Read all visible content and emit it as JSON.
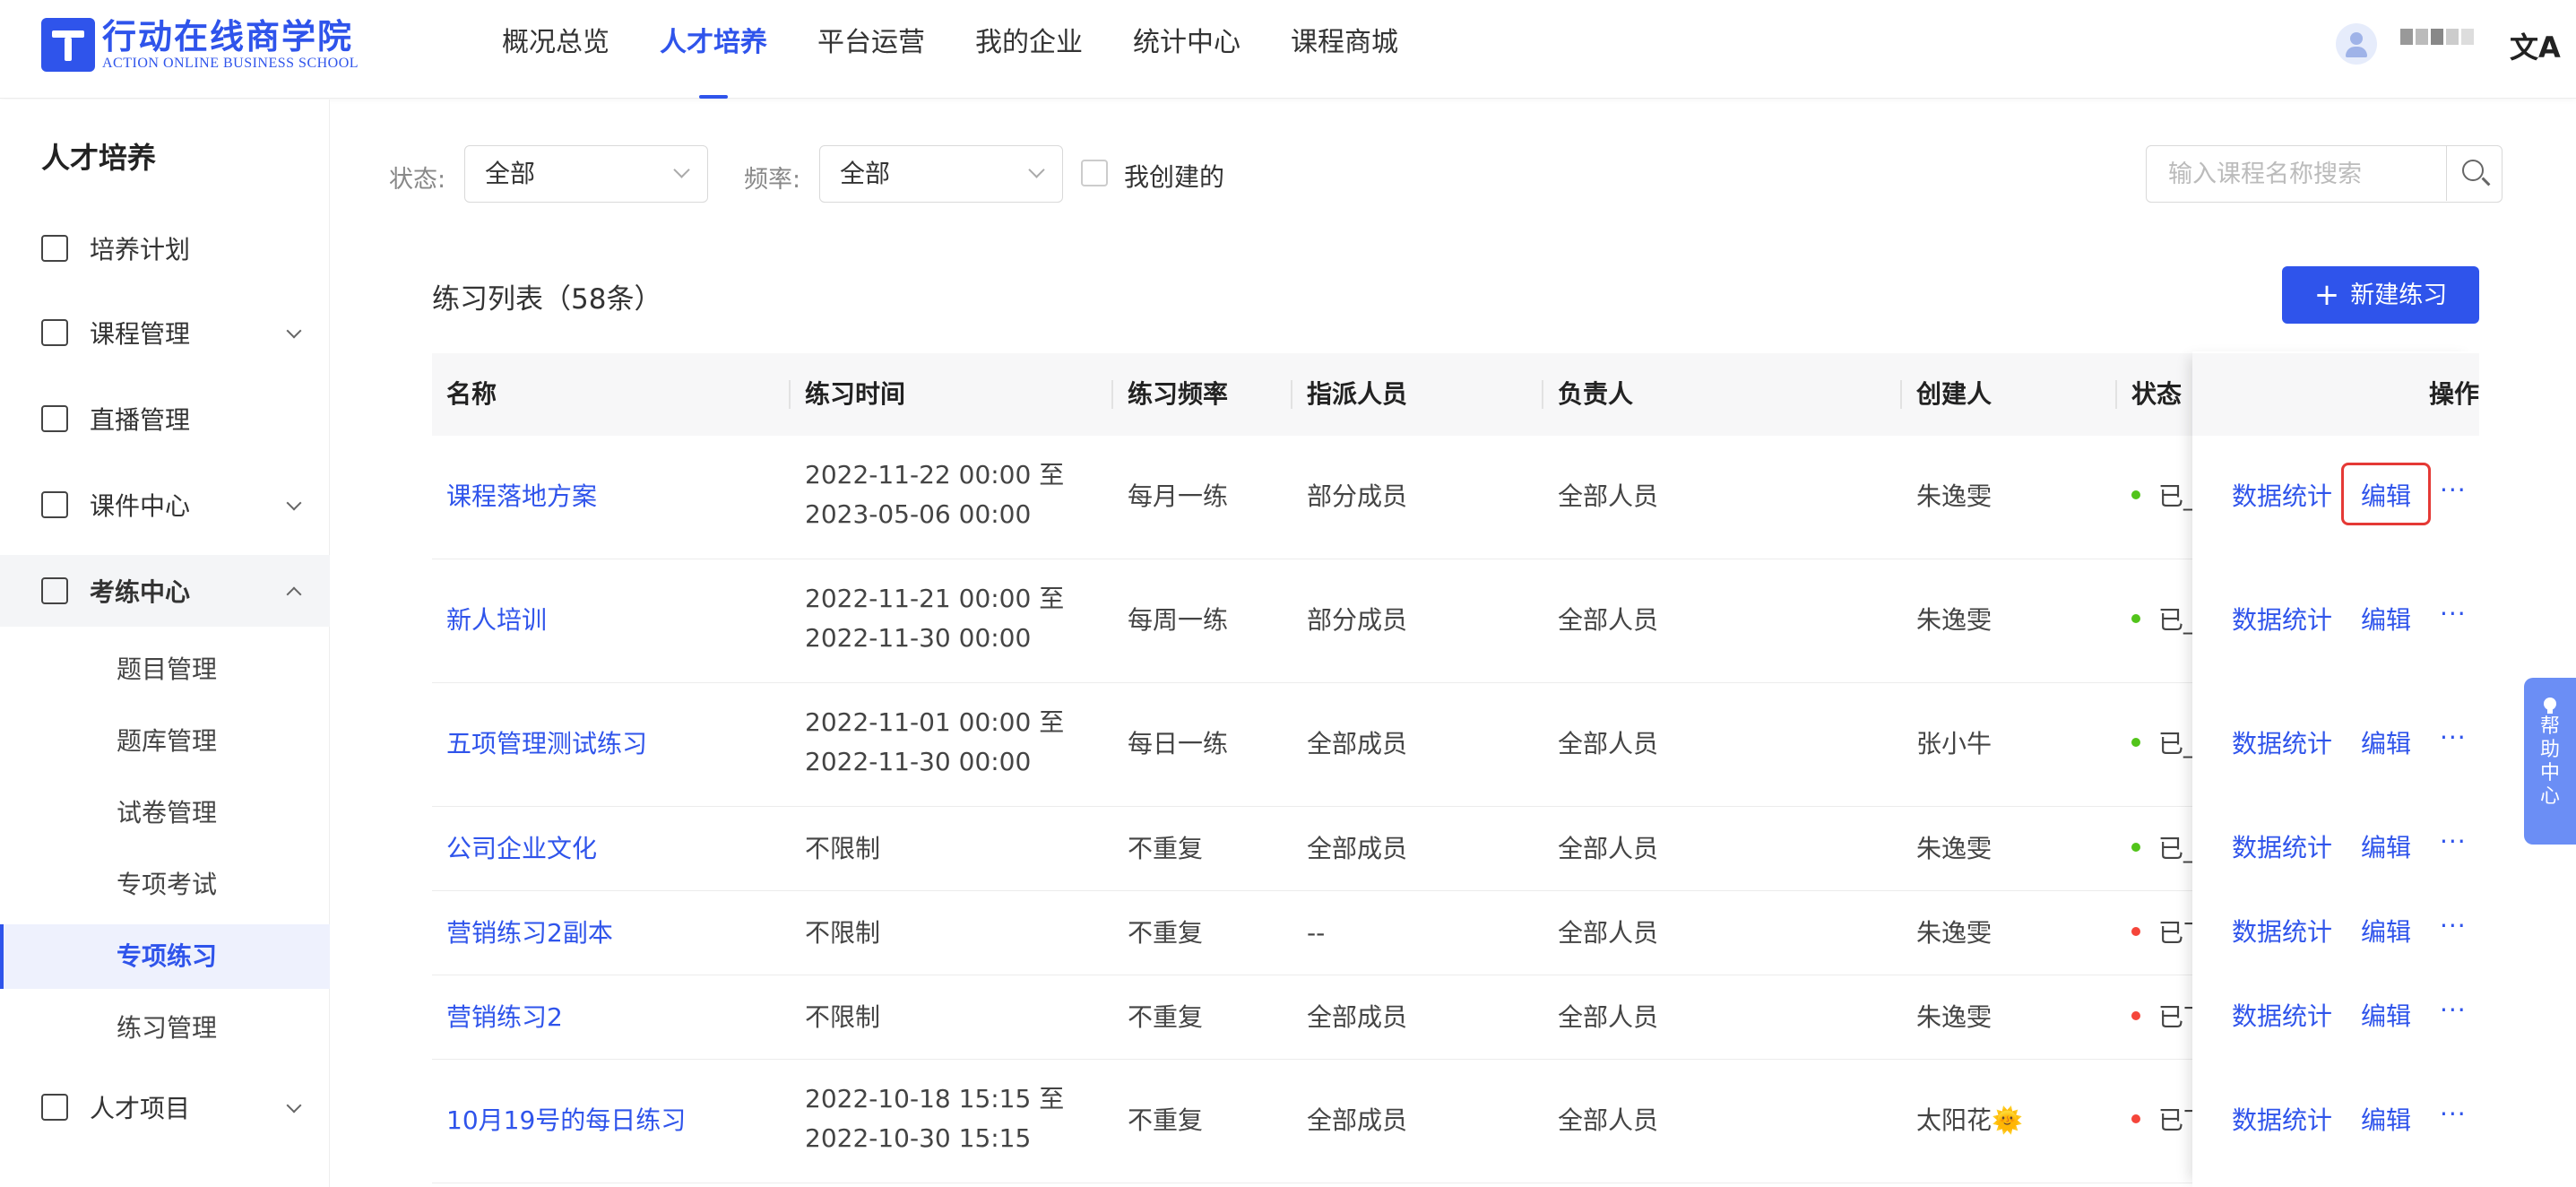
{
  "header": {
    "logo_cn": "行动在线商学院",
    "logo_en": "ACTION ONLINE BUSINESS SCHOOL",
    "nav": [
      "概况总览",
      "人才培养",
      "平台运营",
      "我的企业",
      "统计中心",
      "课程商城"
    ],
    "active_nav": "人才培养",
    "lang_icon": "文A"
  },
  "sidebar": {
    "title": "人才培养",
    "items": [
      {
        "label": "培养计划",
        "icon": "calendar-icon"
      },
      {
        "label": "课程管理",
        "icon": "book-icon"
      },
      {
        "label": "直播管理",
        "icon": "video-icon"
      },
      {
        "label": "课件中心",
        "icon": "inbox-icon"
      },
      {
        "label": "考练中心",
        "icon": "exam-icon"
      },
      {
        "label": "人才项目",
        "icon": "project-icon"
      }
    ],
    "sub_items": [
      "题目管理",
      "题库管理",
      "试卷管理",
      "专项考试",
      "专项练习",
      "练习管理"
    ],
    "active_sub": "专项练习"
  },
  "filters": {
    "status_label": "状态:",
    "status_value": "全部",
    "freq_label": "频率:",
    "freq_value": "全部",
    "mine_label": "我创建的",
    "search_placeholder": "输入课程名称搜索"
  },
  "list": {
    "title": "练习列表（58条）",
    "new_button": "新建练习"
  },
  "table": {
    "columns": [
      "名称",
      "练习时间",
      "练习频率",
      "指派人员",
      "负责人",
      "创建人",
      "状态",
      "操作"
    ],
    "rows": [
      {
        "name": "课程落地方案",
        "time1": "2022-11-22 00:00 至",
        "time2": "2023-05-06 00:00",
        "freq": "每月一练",
        "assign": "部分成员",
        "owner": "全部人员",
        "creator": "朱逸雯",
        "status": "已_",
        "dot": "#52c41a"
      },
      {
        "name": "新人培训",
        "time1": "2022-11-21 00:00 至",
        "time2": "2022-11-30 00:00",
        "freq": "每周一练",
        "assign": "部分成员",
        "owner": "全部人员",
        "creator": "朱逸雯",
        "status": "已_",
        "dot": "#52c41a"
      },
      {
        "name": "五项管理测试练习",
        "time1": "2022-11-01 00:00 至",
        "time2": "2022-11-30 00:00",
        "freq": "每日一练",
        "assign": "全部成员",
        "owner": "全部人员",
        "creator": "张小牛",
        "status": "已_",
        "dot": "#52c41a"
      },
      {
        "name": "公司企业文化",
        "time1": "不限制",
        "time2": "",
        "freq": "不重复",
        "assign": "全部成员",
        "owner": "全部人员",
        "creator": "朱逸雯",
        "status": "已_",
        "dot": "#52c41a"
      },
      {
        "name": "营销练习2副本",
        "time1": "不限制",
        "time2": "",
        "freq": "不重复",
        "assign": "--",
        "owner": "全部人员",
        "creator": "朱逸雯",
        "status": "已丅",
        "dot": "#f5453a"
      },
      {
        "name": "营销练习2",
        "time1": "不限制",
        "time2": "",
        "freq": "不重复",
        "assign": "全部成员",
        "owner": "全部人员",
        "creator": "朱逸雯",
        "status": "已丅",
        "dot": "#f5453a"
      },
      {
        "name": "10月19号的每日练习",
        "time1": "2022-10-18 15:15 至",
        "time2": "2022-10-30 15:15",
        "freq": "不重复",
        "assign": "全部成员",
        "owner": "全部人员",
        "creator": "太阳花🌞",
        "status": "已丅",
        "dot": "#f5453a"
      }
    ],
    "op_stats": "数据统计",
    "op_edit": "编辑",
    "op_more": "···"
  },
  "help": {
    "label": "帮助中心"
  },
  "colors": {
    "primary": "#2f54eb",
    "status_on": "#52c41a",
    "status_off": "#f5453a",
    "highlight": "#e53935"
  }
}
